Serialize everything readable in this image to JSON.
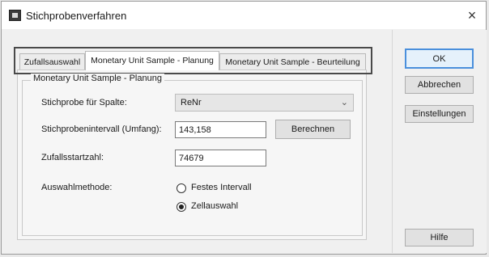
{
  "window": {
    "title": "Stichprobenverfahren",
    "close_label": "×"
  },
  "tabs": [
    {
      "label": "Zufallsauswahl"
    },
    {
      "label": "Monetary Unit Sample - Planung"
    },
    {
      "label": "Monetary Unit Sample - Beurteilung"
    }
  ],
  "group": {
    "title": "Monetary Unit Sample - Planung"
  },
  "form": {
    "column_label": "Stichprobe für Spalte:",
    "column_value": "ReNr",
    "interval_label": "Stichprobenintervall (Umfang):",
    "interval_value": "143,158",
    "calculate_label": "Berechnen",
    "seed_label": "Zufallsstartzahl:",
    "seed_value": "74679",
    "method_label": "Auswahlmethode:",
    "methods": [
      {
        "label": "Festes Intervall",
        "checked": false
      },
      {
        "label": "Zellauswahl",
        "checked": true
      }
    ]
  },
  "buttons": {
    "ok": "OK",
    "cancel": "Abbrechen",
    "settings": "Einstellungen",
    "help": "Hilfe"
  }
}
